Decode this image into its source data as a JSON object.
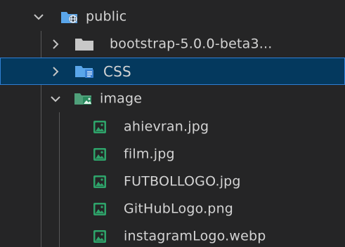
{
  "explorer": {
    "colors": {
      "background": "#252526",
      "selected_background": "#04395e",
      "selected_border": "#2f7fd4",
      "text": "#d4d4d4",
      "chevron": "#c5c5c5",
      "folder_gray": "#c8c8c8",
      "folder_blue": "#5aa6ea",
      "image_icon": "#2ea36a"
    },
    "tree": [
      {
        "label": "public",
        "kind": "folder",
        "expanded": true,
        "icon": "folder-web-icon"
      },
      {
        "label": "bootstrap-5.0.0-beta3...",
        "kind": "folder",
        "expanded": false,
        "icon": "folder-icon"
      },
      {
        "label": "CSS",
        "kind": "folder",
        "expanded": false,
        "selected": true,
        "icon": "folder-css-icon"
      },
      {
        "label": "image",
        "kind": "folder",
        "expanded": true,
        "icon": "folder-image-icon"
      },
      {
        "label": "ahievran.jpg",
        "kind": "file",
        "icon": "image-file-icon"
      },
      {
        "label": "film.jpg",
        "kind": "file",
        "icon": "image-file-icon"
      },
      {
        "label": "FUTBOLLOGO.jpg",
        "kind": "file",
        "icon": "image-file-icon"
      },
      {
        "label": "GitHubLogo.png",
        "kind": "file",
        "icon": "image-file-icon"
      },
      {
        "label": "instagramLogo.webp",
        "kind": "file",
        "icon": "image-file-icon"
      }
    ]
  }
}
